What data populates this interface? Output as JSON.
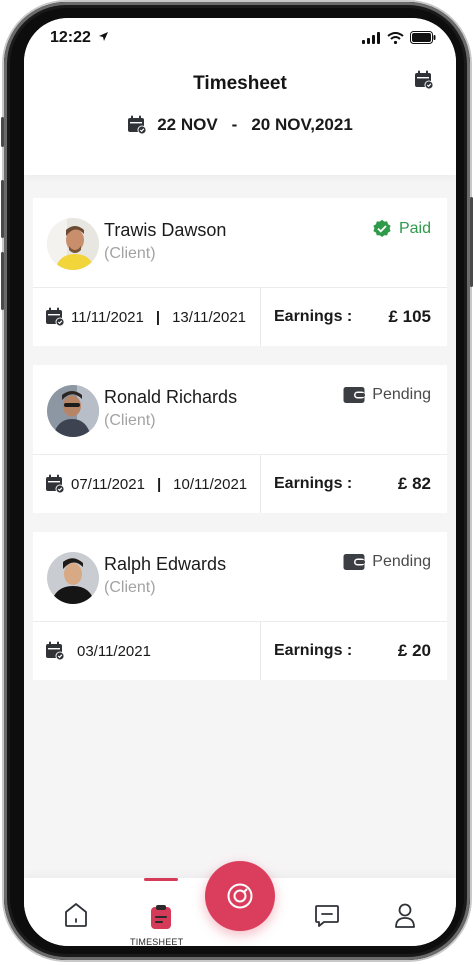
{
  "status_bar": {
    "time": "12:22"
  },
  "header": {
    "title": "Timesheet",
    "date_start": "22 NOV",
    "date_separator": "-",
    "date_end": "20 NOV,2021"
  },
  "colors": {
    "accent": "#db3e5c",
    "paid": "#2e9a4a",
    "pending": "#3b3f44"
  },
  "timesheets": [
    {
      "name": "Trawis Dawson",
      "role": "(Client)",
      "status": "Paid",
      "status_icon": "check-badge-icon",
      "date_from": "11/11/2021",
      "date_sep": "|",
      "date_to": "13/11/2021",
      "earnings_label": "Earnings :",
      "amount": "£ 105"
    },
    {
      "name": "Ronald Richards",
      "role": "(Client)",
      "status": "Pending",
      "status_icon": "wallet-icon",
      "date_from": "07/11/2021",
      "date_sep": "|",
      "date_to": "10/11/2021",
      "earnings_label": "Earnings :",
      "amount": "£ 82"
    },
    {
      "name": "Ralph Edwards",
      "role": "(Client)",
      "status": "Pending",
      "status_icon": "wallet-icon",
      "date_from": "03/11/2021",
      "earnings_label": "Earnings :",
      "amount": "£ 20"
    }
  ],
  "bottom_nav": {
    "items": [
      {
        "icon": "home-icon"
      },
      {
        "icon": "timesheet-icon",
        "label": "TIMESHEET",
        "active": true
      },
      {
        "icon": "target-icon"
      },
      {
        "icon": "chat-icon"
      },
      {
        "icon": "profile-icon"
      }
    ]
  }
}
